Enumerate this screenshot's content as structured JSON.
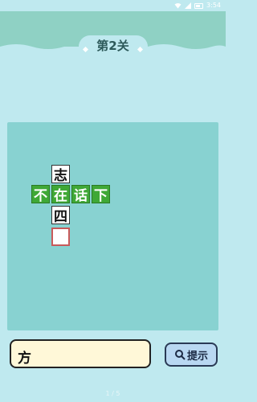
{
  "status": {
    "time": "3:54"
  },
  "header": {
    "title": "第2关"
  },
  "board": {
    "tiles": [
      {
        "char": "志",
        "style": "white"
      },
      {
        "char": "不",
        "style": "green"
      },
      {
        "char": "在",
        "style": "green"
      },
      {
        "char": "话",
        "style": "green"
      },
      {
        "char": "下",
        "style": "green"
      },
      {
        "char": "四",
        "style": "white"
      },
      {
        "char": "",
        "style": "empty"
      }
    ]
  },
  "answer": {
    "char": "方"
  },
  "hint_button": {
    "label": "提示",
    "icon": "search-icon"
  },
  "pager": {
    "text": "1 / 5"
  }
}
